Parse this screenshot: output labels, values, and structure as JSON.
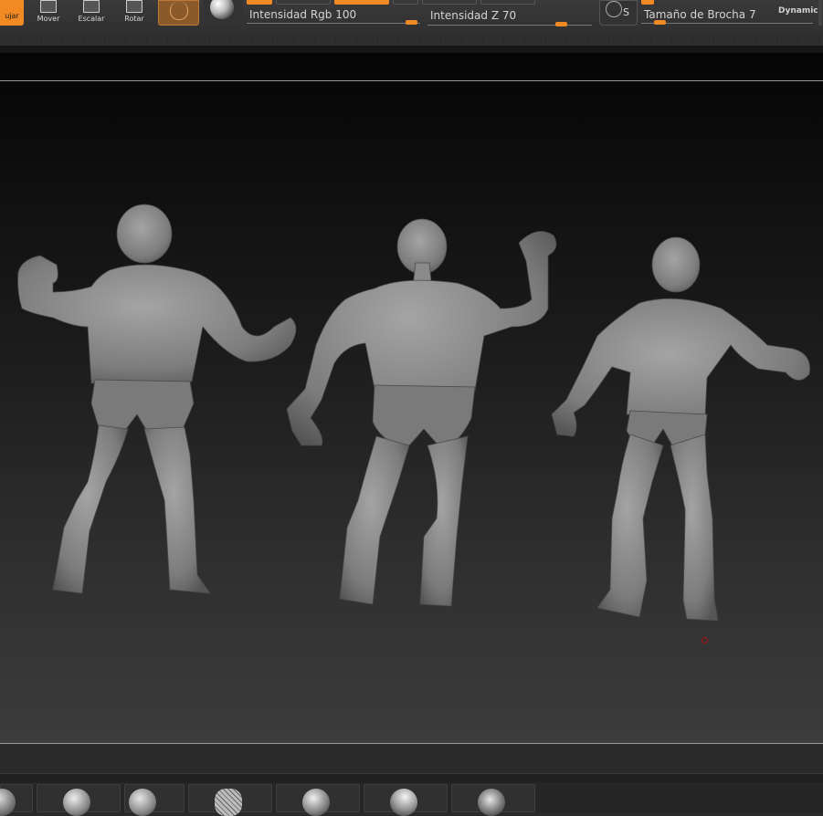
{
  "toolbar": {
    "draw_label": "ujar",
    "move_label": "Mover",
    "scale_label": "Escalar",
    "rotate_label": "Rotar",
    "rgb_intensity_label": "Intensidad Rgb",
    "rgb_intensity_value": "100",
    "z_intensity_label": "Intensidad Z",
    "z_intensity_value": "70",
    "brush_size_label": "Tamaño de Brocha",
    "brush_size_value": "7",
    "dynamic_label": "Dynamic",
    "symmetry_label": "S"
  },
  "icons": {
    "move": "move-icon",
    "scale": "scale-icon",
    "rotate": "rotate-icon",
    "material": "material-icon",
    "matcap": "matcap-sphere-icon",
    "symmetry": "symmetry-icon",
    "brushes": [
      "standard-brush-icon",
      "sphere-brush-icon",
      "clay-brush-icon",
      "mesh-brush-icon",
      "inflate-brush-icon",
      "smooth-brush-icon",
      "dam-standard-brush-icon"
    ]
  },
  "colors": {
    "accent": "#f28a24",
    "canvas_top": "#050505",
    "canvas_bottom": "#3c3c3c",
    "pivot": "#b01010"
  }
}
